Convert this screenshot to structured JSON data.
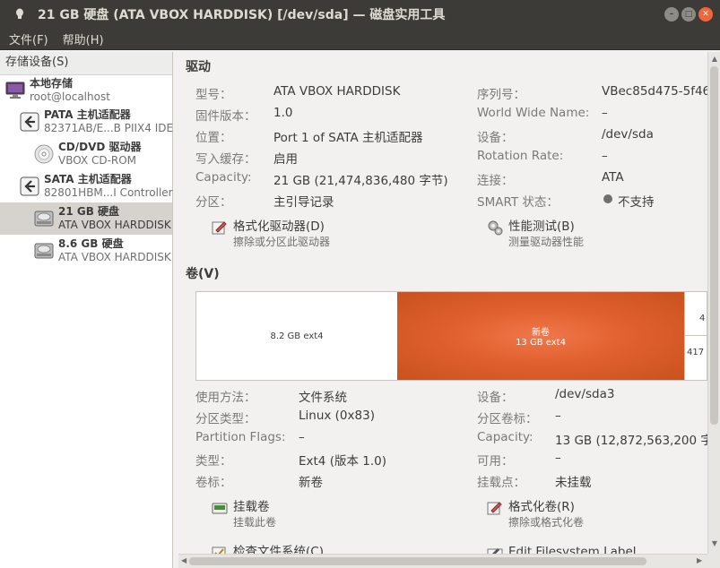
{
  "window": {
    "title": "21 GB 硬盘 (ATA VBOX HARDDISK) [/dev/sda] — 磁盘实用工具"
  },
  "menu": [
    "文件(F)",
    "帮助(H)"
  ],
  "sidebar": {
    "header": "存储设备(S)",
    "items": [
      {
        "title": "本地存储",
        "sub": "root@localhost",
        "icon": "computer-icon"
      },
      {
        "title": "PATA 主机适配器",
        "sub": "82371AB/E...B PIIX4 IDE",
        "icon": "controller-icon"
      },
      {
        "title": "CD/DVD 驱动器",
        "sub": "VBOX CD-ROM",
        "icon": "optical-disc-icon"
      },
      {
        "title": "SATA 主机适配器",
        "sub": "82801HBM...I Controller",
        "icon": "controller-icon"
      },
      {
        "title": "21 GB 硬盘",
        "sub": "ATA VBOX HARDDISK",
        "icon": "hard-disk-icon",
        "selected": true
      },
      {
        "title": "8.6 GB 硬盘",
        "sub": "ATA VBOX HARDDISK",
        "icon": "hard-disk-icon"
      }
    ]
  },
  "drive": {
    "heading": "驱动",
    "left": [
      {
        "label": "型号：",
        "value": "ATA VBOX HARDDISK"
      },
      {
        "label": "固件版本：",
        "value": "1.0"
      },
      {
        "label": "位置：",
        "value": "Port 1 of SATA 主机适配器"
      },
      {
        "label": "写入缓存：",
        "value": "启用"
      },
      {
        "label": "Capacity:",
        "value": "21 GB (21,474,836,480 字节)"
      },
      {
        "label": "分区：",
        "value": "主引导记录"
      }
    ],
    "right": [
      {
        "label": "序列号：",
        "value": "VBec85d475-5f46"
      },
      {
        "label": "World Wide Name:",
        "value": "–"
      },
      {
        "label": "设备：",
        "value": "/dev/sda"
      },
      {
        "label": "Rotation Rate:",
        "value": "–"
      },
      {
        "label": "连接：",
        "value": "ATA"
      },
      {
        "label": "SMART 状态：",
        "value": "不支持"
      }
    ],
    "actions": [
      {
        "title": "格式化驱动器(D)",
        "sub": "擦除或分区此驱动器",
        "icon": "format-drive-icon"
      },
      {
        "title": "性能测试(B)",
        "sub": "测量驱动器性能",
        "icon": "benchmark-icon"
      }
    ]
  },
  "volumes": {
    "heading": "卷(V)",
    "partitions": [
      {
        "label": "",
        "sub": "8.2 GB ext4"
      },
      {
        "label": "新卷",
        "sub": "13 GB ext4"
      },
      {
        "top": "4",
        "bottom": "417"
      }
    ],
    "left": [
      {
        "label": "使用方法：",
        "value": "文件系统"
      },
      {
        "label": "分区类型：",
        "value": "Linux (0x83)"
      },
      {
        "label": "Partition Flags:",
        "value": "–"
      },
      {
        "label": "类型：",
        "value": "Ext4 (版本 1.0)"
      },
      {
        "label": "卷标：",
        "value": "新卷"
      }
    ],
    "right": [
      {
        "label": "设备：",
        "value": "/dev/sda3"
      },
      {
        "label": "分区卷标：",
        "value": "–"
      },
      {
        "label": "Capacity:",
        "value": "13 GB (12,872,563,200 字"
      },
      {
        "label": "可用：",
        "value": "–"
      },
      {
        "label": "挂载点：",
        "value": "未挂载"
      }
    ],
    "actions": [
      {
        "title": "挂载卷",
        "sub": "挂载此卷",
        "icon": "mount-icon"
      },
      {
        "title": "格式化卷(R)",
        "sub": "擦除或格式化卷",
        "icon": "format-volume-icon"
      },
      {
        "title": "检查文件系统(C)",
        "sub": "",
        "icon": "check-fs-icon"
      },
      {
        "title": "Edit Filesystem Label",
        "sub": "",
        "icon": "edit-label-icon"
      }
    ]
  },
  "colors": {
    "titlebar": "#3c3b37",
    "selected_partition": "#e0602e",
    "close_button": "#f0663b"
  }
}
